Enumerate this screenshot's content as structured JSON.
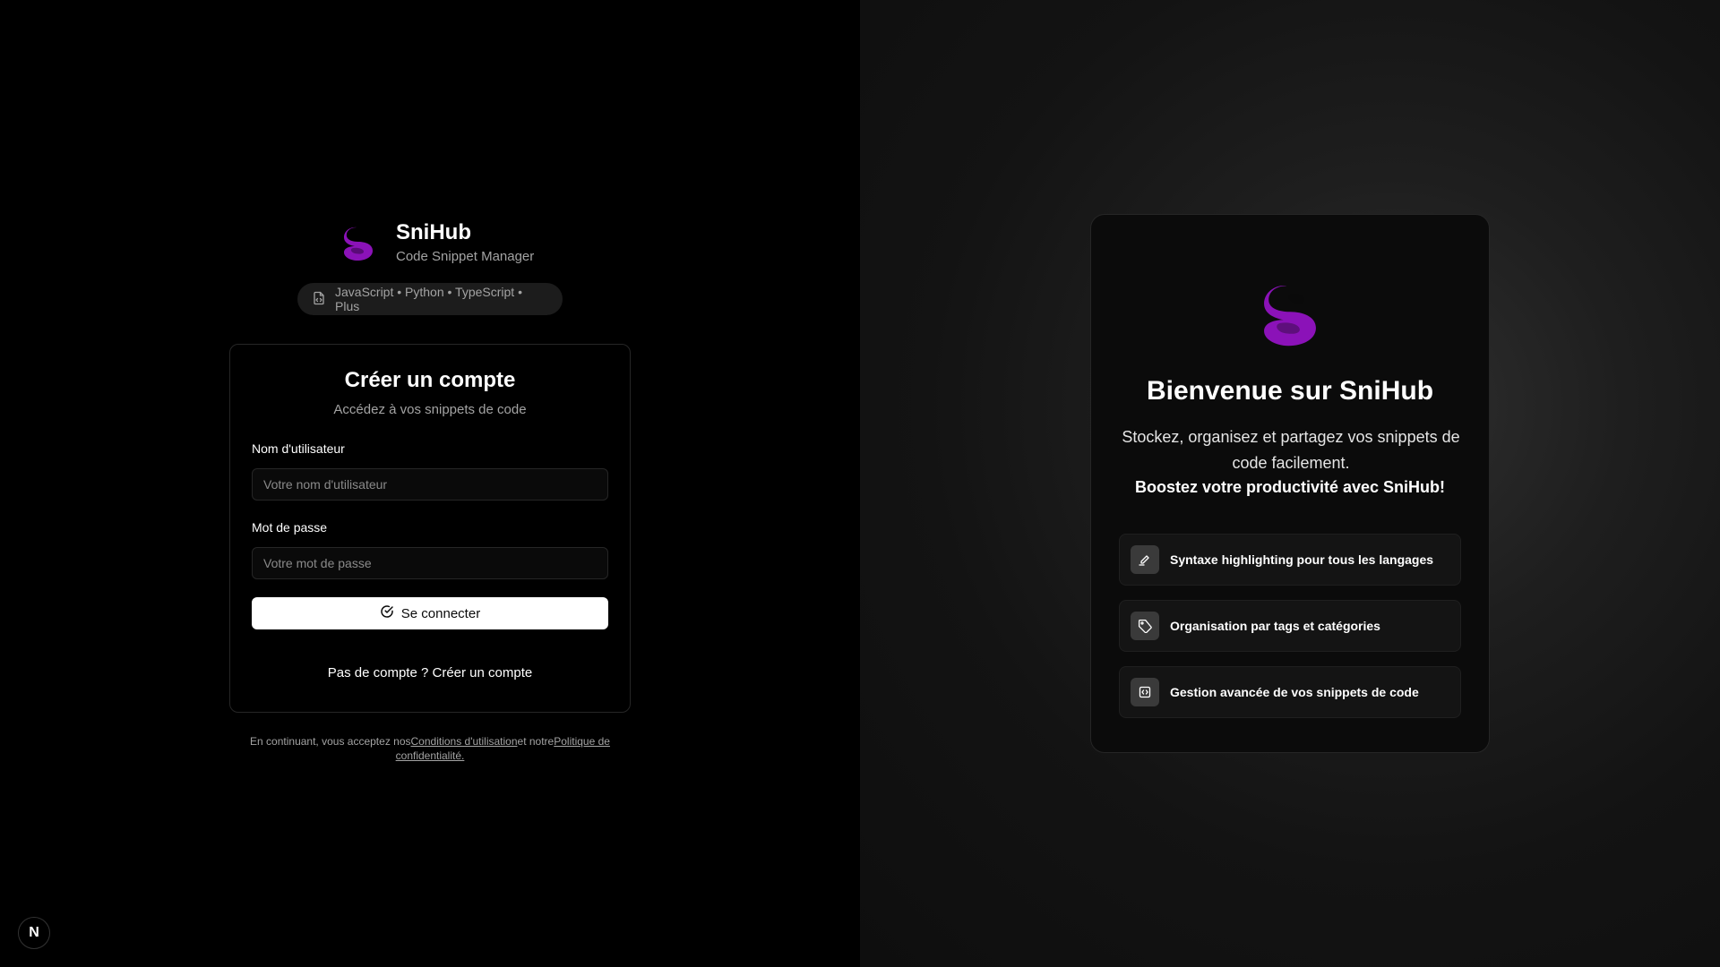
{
  "brand": {
    "name": "SniHub",
    "tagline": "Code Snippet Manager",
    "accent_color": "#8b12b8"
  },
  "languages_pill": {
    "icon": "file-code-icon",
    "text": "JavaScript • Python • TypeScript • Plus"
  },
  "form": {
    "title": "Créer un compte",
    "subtitle": "Accédez à vos snippets de code",
    "username_label": "Nom d'utilisateur",
    "username_placeholder": "Votre nom d'utilisateur",
    "username_value": "",
    "password_label": "Mot de passe",
    "password_placeholder": "Votre mot de passe",
    "password_value": "",
    "submit_icon": "check-circle-icon",
    "submit_label": "Se connecter",
    "signup_text": "Pas de compte ? Créer un compte"
  },
  "terms": {
    "prefix": "En continuant, vous acceptez nos",
    "terms_link": "Conditions d'utilisation",
    "middle": "et notre",
    "privacy_link": "Politique de confidentialité."
  },
  "dev_badge": {
    "label": "N"
  },
  "welcome": {
    "title": "Bienvenue sur SniHub",
    "description": "Stockez, organisez et partagez vos snippets de code facilement.",
    "highlight": "Boostez votre productivité avec SniHub!",
    "features": [
      {
        "icon": "highlighter-icon",
        "label": "Syntaxe highlighting pour tous les langages"
      },
      {
        "icon": "tag-icon",
        "label": "Organisation par tags et catégories"
      },
      {
        "icon": "code-square-icon",
        "label": "Gestion avancée de vos snippets de code"
      }
    ]
  }
}
